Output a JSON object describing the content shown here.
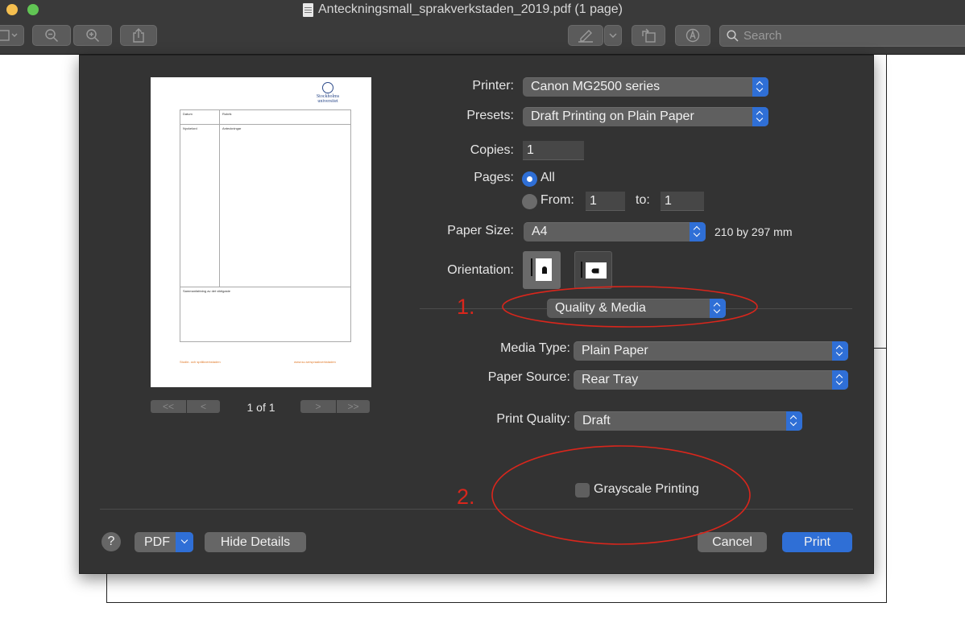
{
  "window": {
    "title": "Anteckningsmall_sprakverkstaden_2019.pdf (1 page)"
  },
  "toolbar": {
    "search_placeholder": "Search",
    "icons": [
      "sidebar-icon",
      "zoom-out-icon",
      "zoom-in-icon",
      "share-icon",
      "markup-icon",
      "chevron-down-icon",
      "rotate-icon",
      "annotate-icon",
      "search-icon"
    ]
  },
  "preview": {
    "page_counter": "1 of 1",
    "nav_first": "<<",
    "nav_prev": "<",
    "nav_next": ">",
    "nav_last": ">>",
    "doc": {
      "logo_line1": "Stockholms",
      "logo_line2": "universitet",
      "datum": "Datum",
      "rubrik": "Rubrik",
      "nyckelord": "Nyckelord",
      "anteckningar": "Anteckningar",
      "sammanfattning": "Sammanfattning av det viktigaste",
      "footer_left": "Studie- och språkverkstaden",
      "footer_right": "www.su.se/spraakverkstaden"
    }
  },
  "printer": {
    "label": "Printer:",
    "value": "Canon MG2500 series"
  },
  "presets": {
    "label": "Presets:",
    "value": "Draft Printing on Plain Paper"
  },
  "copies": {
    "label": "Copies:",
    "value": "1"
  },
  "pages": {
    "label": "Pages:",
    "all_label": "All",
    "from_label": "From:",
    "from_value": "1",
    "to_label": "to:",
    "to_value": "1",
    "selected": "All"
  },
  "paper_size": {
    "label": "Paper Size:",
    "value": "A4",
    "dimensions": "210 by 297 mm"
  },
  "orientation": {
    "label": "Orientation:",
    "selected": "portrait"
  },
  "section": {
    "value": "Quality & Media"
  },
  "media_type": {
    "label": "Media Type:",
    "value": "Plain Paper"
  },
  "paper_source": {
    "label": "Paper Source:",
    "value": "Rear Tray"
  },
  "print_quality": {
    "label": "Print Quality:",
    "value": "Draft"
  },
  "grayscale": {
    "label": "Grayscale Printing",
    "checked": false
  },
  "buttons": {
    "help": "?",
    "pdf": "PDF",
    "hide_details": "Hide Details",
    "cancel": "Cancel",
    "print": "Print"
  },
  "annotations": {
    "marker_1": "1.",
    "marker_2": "2.",
    "color": "#d9261c"
  },
  "colors": {
    "accent": "#2f6fd6",
    "dialog_bg": "#333333"
  }
}
